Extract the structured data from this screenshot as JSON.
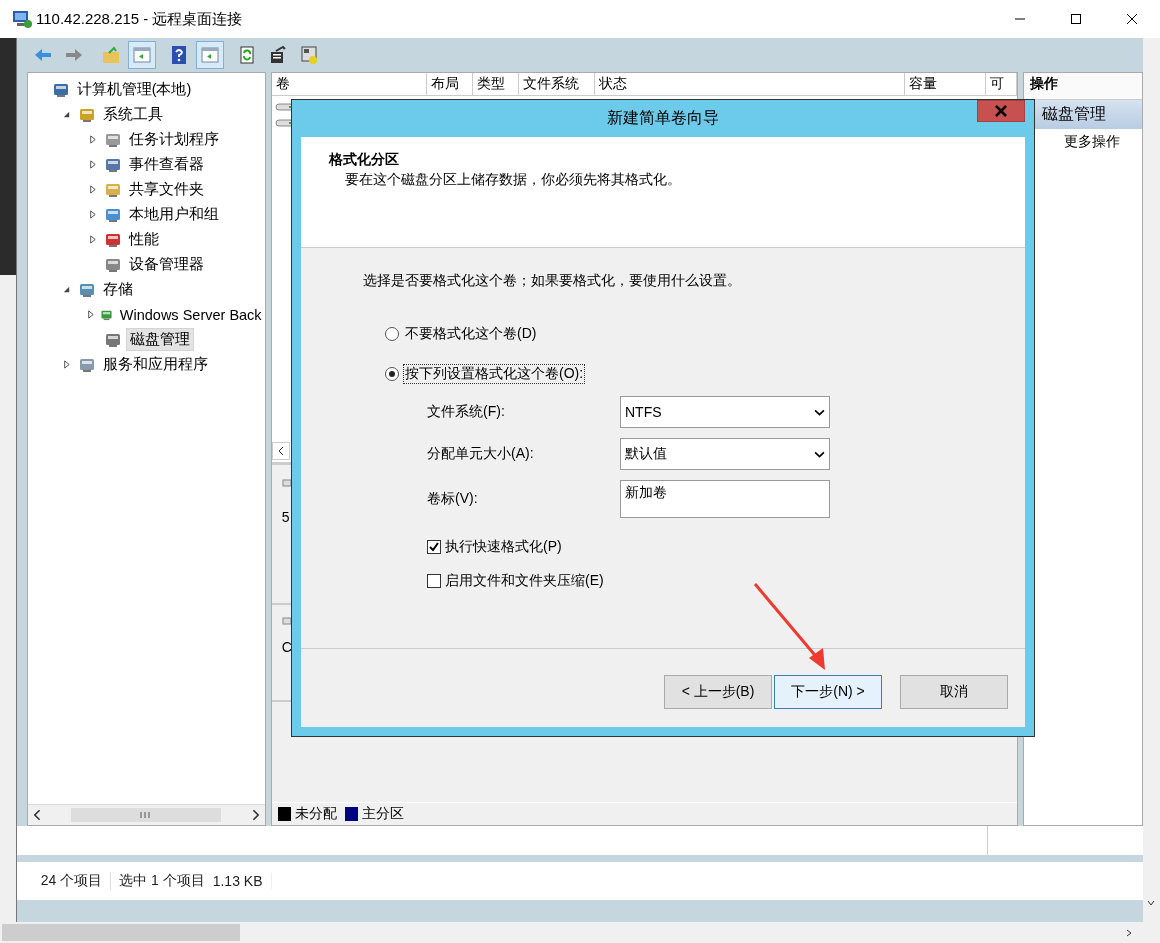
{
  "window": {
    "title": "110.42.228.215 - 远程桌面连接"
  },
  "toolbar": [
    {
      "pressed": false
    },
    {
      "pressed": false
    },
    {
      "pressed": false
    },
    {
      "pressed": true
    },
    {
      "pressed": false
    },
    {
      "pressed": true
    },
    {
      "pressed": false
    },
    {
      "pressed": false
    },
    {
      "pressed": false
    }
  ],
  "tree": [
    {
      "label": "计算机管理(本地)",
      "selected": false,
      "children": [
        {
          "label": "系统工具",
          "selected": false,
          "expanded": true,
          "children": [
            {
              "label": "任务计划程序",
              "selected": false,
              "expanded": false
            },
            {
              "label": "事件查看器",
              "selected": false,
              "expanded": false
            },
            {
              "label": "共享文件夹",
              "selected": false,
              "expanded": false
            },
            {
              "label": "本地用户和组",
              "selected": false,
              "expanded": false
            },
            {
              "label": "性能",
              "selected": false,
              "expanded": false
            },
            {
              "label": "设备管理器",
              "selected": false
            }
          ]
        },
        {
          "label": "存储",
          "selected": false,
          "expanded": true,
          "children": [
            {
              "label": "Windows Server Back",
              "selected": false,
              "expanded": false
            },
            {
              "label": "磁盘管理",
              "selected": true
            }
          ]
        },
        {
          "label": "服务和应用程序",
          "selected": false,
          "expanded": false
        }
      ]
    }
  ],
  "volume_table": {
    "columns": [
      "卷",
      "布局",
      "类型",
      "文件系统",
      "状态",
      "容量",
      "可"
    ]
  },
  "disk_panel": {
    "disk_1_line": "5",
    "disk_2_line": "C"
  },
  "legend": [
    {
      "label": "未分配",
      "color": "#000000"
    },
    {
      "label": "主分区",
      "color": "#000080"
    }
  ],
  "actions": {
    "header": "操作",
    "items": [
      {
        "label": "磁盘管理",
        "kind": "section"
      },
      {
        "label": "更多操作",
        "kind": "link"
      }
    ]
  },
  "status_bar": [
    "24 个项目",
    "选中 1 个项目",
    "1.13 KB"
  ],
  "dialog": {
    "title": "新建简单卷向导",
    "heading": "格式化分区",
    "subheading": "要在这个磁盘分区上储存数据，你必须先将其格式化。",
    "prompt": "选择是否要格式化这个卷；如果要格式化，要使用什么设置。",
    "radios": [
      {
        "label": "不要格式化这个卷(D)",
        "selected": false
      },
      {
        "label": "按下列设置格式化这个卷(O):",
        "selected": true
      }
    ],
    "fields": [
      {
        "label": "文件系统(F):",
        "value": "NTFS",
        "kind": "dropdown"
      },
      {
        "label": "分配单元大小(A):",
        "value": "默认值",
        "kind": "dropdown"
      },
      {
        "label": "卷标(V):",
        "value": "新加卷",
        "kind": "text"
      }
    ],
    "checkboxes": [
      {
        "label": "执行快速格式化(P)",
        "checked": true
      },
      {
        "label": "启用文件和文件夹压缩(E)",
        "checked": false
      }
    ],
    "buttons": [
      {
        "label": "< 上一步(B)",
        "kind": "normal",
        "focused": false
      },
      {
        "label": "下一步(N) >",
        "kind": "normal",
        "focused": true
      },
      {
        "label": "取消",
        "kind": "cancel",
        "focused": false
      }
    ]
  }
}
